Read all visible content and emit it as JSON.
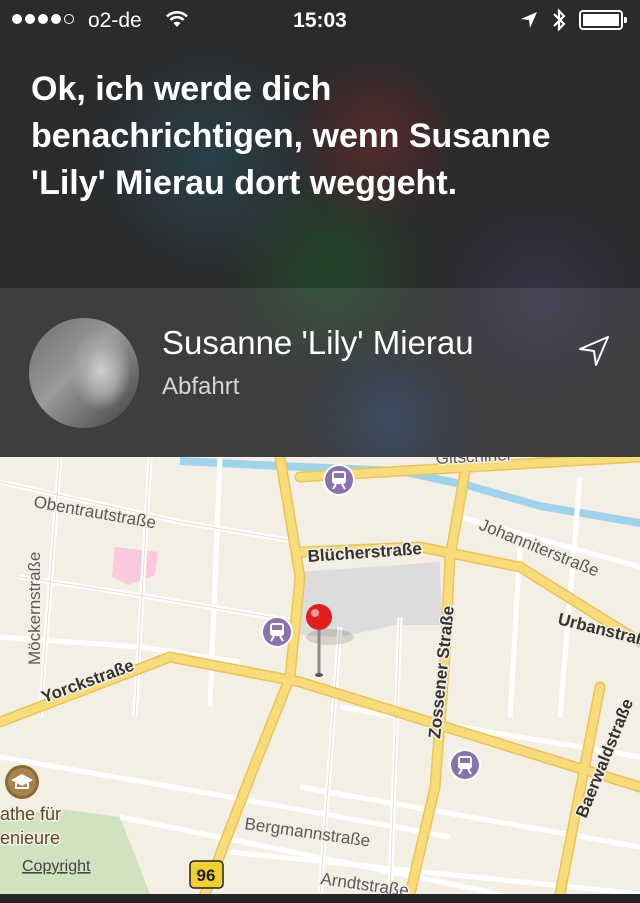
{
  "status_bar": {
    "carrier": "o2-de",
    "time": "15:03",
    "signal_bars_filled": 4,
    "signal_bars_total": 5,
    "battery_level": 1.0
  },
  "siri": {
    "message": "Ok, ich werde dich benachrichtigen, wenn Susanne 'Lily' Mierau dort weggeht."
  },
  "contact": {
    "name": "Susanne 'Lily' Mierau",
    "subtitle": "Abfahrt"
  },
  "map": {
    "streets": {
      "obentrautstrasse": "Obentrautstraße",
      "bluecherstrasse": "Blücherstraße",
      "johanniterstrasse": "Johanniterstraße",
      "urbanstrasse": "Urbanstraße",
      "zossener_strasse": "Zossener Straße",
      "yorckstrasse": "Yorckstraße",
      "moeckernstrasse": "Möckernstraße",
      "baerwaldstrasse": "Baerwaldstraße",
      "bergmannstrasse": "Bergmannstraße",
      "arndtstrasse": "Arndtstraße",
      "gitschiner": "Gitschiner"
    },
    "poi_fragment_1": "athe für",
    "poi_fragment_2": "enieure",
    "copyright": "Copyright",
    "route_shield": "96",
    "colors": {
      "pin": "#e0201f",
      "transit": "#8a72ad",
      "major_road": "#f7d36b",
      "water": "#9fd3ec",
      "park": "#cfe3c0"
    }
  }
}
